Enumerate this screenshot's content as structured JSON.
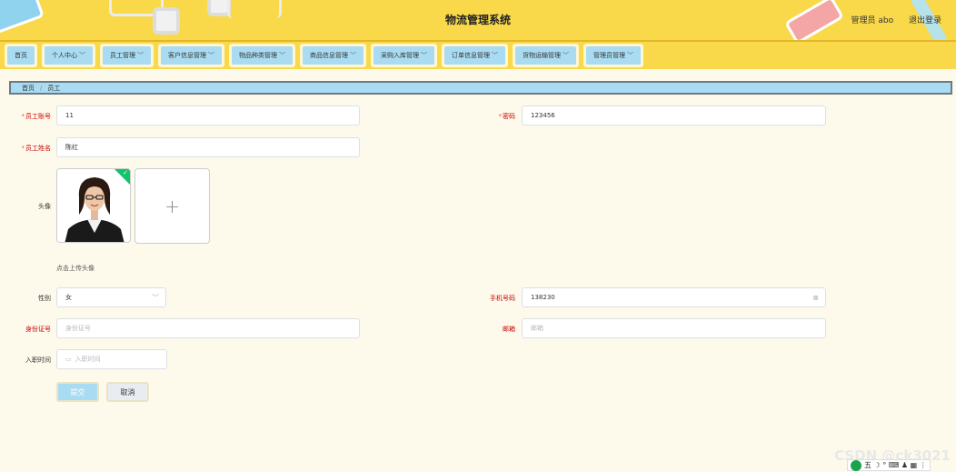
{
  "header": {
    "title": "物流管理系统",
    "user_label": "管理员 abo",
    "logout_label": "退出登录"
  },
  "nav": {
    "items": [
      {
        "label": "首页",
        "has_dropdown": false
      },
      {
        "label": "个人中心",
        "has_dropdown": true
      },
      {
        "label": "员工管理",
        "has_dropdown": true
      },
      {
        "label": "客户信息管理",
        "has_dropdown": true
      },
      {
        "label": "物品种类管理",
        "has_dropdown": true
      },
      {
        "label": "商品信息管理",
        "has_dropdown": true
      },
      {
        "label": "采购入库管理",
        "has_dropdown": true
      },
      {
        "label": "订单信息管理",
        "has_dropdown": true
      },
      {
        "label": "货物运输管理",
        "has_dropdown": true
      },
      {
        "label": "管理员管理",
        "has_dropdown": true
      }
    ],
    "chevron": "﹀"
  },
  "breadcrumb": {
    "home": "首页",
    "separator": "/",
    "current": "员工"
  },
  "form": {
    "account": {
      "label": "员工账号",
      "value": "11",
      "required": true
    },
    "password": {
      "label": "密码",
      "value": "123456",
      "required": true
    },
    "name": {
      "label": "员工姓名",
      "value": "陈红",
      "required": true
    },
    "avatar": {
      "label": "头像",
      "hint": "点击上传头像",
      "plus": "+",
      "check": "✓"
    },
    "gender": {
      "label": "性别",
      "value": "女"
    },
    "phone": {
      "label": "手机号码",
      "value": "138230"
    },
    "id_card": {
      "label": "身份证号",
      "placeholder": "身份证号"
    },
    "email": {
      "label": "邮箱",
      "placeholder": "邮箱"
    },
    "hire_date": {
      "label": "入职时间",
      "placeholder": "入职时间"
    },
    "submit_label": "提交",
    "cancel_label": "取消"
  },
  "colors": {
    "header_bg": "#f9d94a",
    "nav_item_bg": "#a9dcf2",
    "page_bg": "#fdfaeb",
    "required": "#e53333",
    "success": "#13c26b"
  },
  "overlay": {
    "watermark": "CSDN @ck3021",
    "ime_label": "五 ☽ ° ⌨ ♟ ▦ ⋮"
  }
}
